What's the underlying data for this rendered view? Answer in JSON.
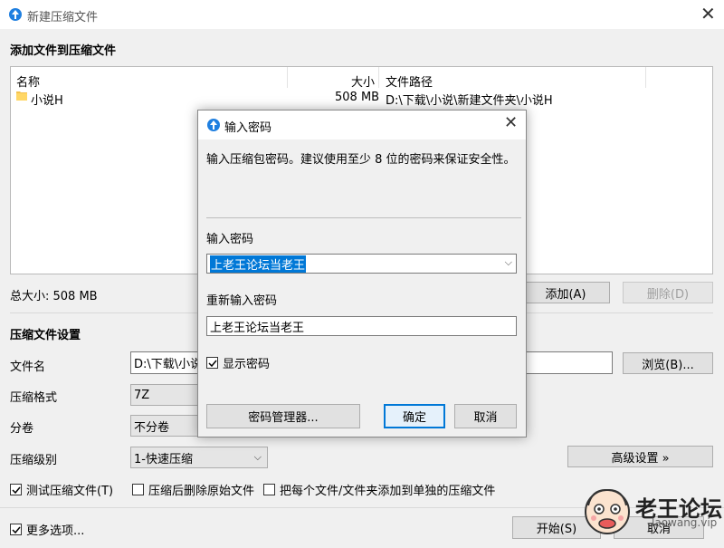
{
  "main": {
    "title": "新建压缩文件",
    "section_add": "添加文件到压缩文件",
    "list_headers": {
      "name": "名称",
      "size": "大小",
      "path": "文件路径"
    },
    "files": [
      {
        "name": "小说H",
        "size": "508 MB",
        "path": "D:\\下载\\小说\\新建文件夹\\小说H"
      }
    ],
    "total_size": "总大小: 508 MB",
    "add_button": "添加(A)",
    "delete_button": "删除(D)",
    "section_settings": "压缩文件设置",
    "filename_label": "文件名",
    "filename_value": "D:\\下载\\小说",
    "browse_button": "浏览(B)...",
    "format_label": "压缩格式",
    "format_value": "7Z",
    "volume_label": "分卷",
    "volume_value": "不分卷",
    "level_label": "压缩级别",
    "level_value": "1-快速压缩",
    "advanced_button": "高级设置 »",
    "test_check": "测试压缩文件(T)",
    "test_checked": true,
    "delete_after_check": "压缩后删除原始文件",
    "delete_after_checked": false,
    "separate_check": "把每个文件/文件夹添加到单独的压缩文件",
    "separate_checked": false,
    "more_options_check": "更多选项...",
    "more_options_checked": true,
    "start_button": "开始(S)",
    "cancel_button": "取消"
  },
  "dialog": {
    "title": "输入密码",
    "description": "输入压缩包密码。建议使用至少 8 位的密码来保证安全性。",
    "password_label": "输入密码",
    "password_value": "上老王论坛当老王",
    "reenter_label": "重新输入密码",
    "reenter_value": "上老王论坛当老王",
    "show_password": "显示密码",
    "show_password_checked": true,
    "manager_button": "密码管理器...",
    "ok_button": "确定",
    "cancel_button": "取消"
  },
  "watermark": {
    "brand": "老王论坛",
    "url": "laowang.vip"
  },
  "icons": {
    "app": "bandizip-arrow-icon",
    "folder": "folder-icon",
    "close": "close-icon",
    "dropdown": "chevron-down-icon",
    "check": "checkmark-icon"
  },
  "colors": {
    "accent": "#0078d7",
    "app_icon": "#1f7fe0",
    "folder": "#f4c14e"
  }
}
